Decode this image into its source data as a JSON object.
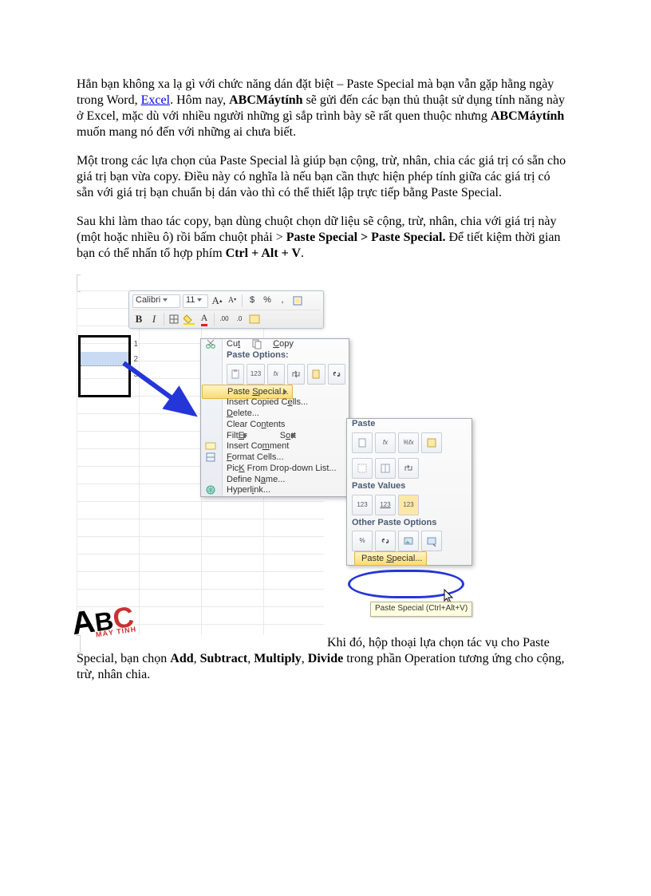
{
  "para1": {
    "t1": "Hẳn bạn không xa lạ gì với chức năng dán đặt biệt – Paste Special mà bạn vẫn gặp hằng ngày trong Word, ",
    "link": "Excel",
    "t2": ". Hôm nay, ",
    "b1": "ABCMáytính",
    "t3": " sẽ gửi đến các bạn thủ thuật sử dụng tính năng này ở Excel, mặc dù với nhiều người những gì sắp trình bày sẽ rất quen thuộc nhưng ",
    "b2": "ABCMáytính",
    "t4": " muốn mang nó đến với những ai chưa biết."
  },
  "para2": "Một trong các lựa chọn của Paste Special là giúp bạn cộng, trừ, nhân, chia các giá trị có sẵn cho giá trị bạn vừa copy. Điều này có nghĩa là nếu bạn cần thực hiện phép tính giữa các giá trị có sẵn với giá trị bạn chuẩn bị dán vào thì có thể thiết lập trực tiếp bằng Paste Special.",
  "para3": {
    "t1": "Sau khi làm thao tác copy, bạn dùng chuột chọn dữ liệu sẽ cộng, trừ, nhân, chia với giá trị này (một hoặc nhiều ô) rồi bấm chuột phải > ",
    "b1": "Paste Special > Paste Special.",
    "t2": " Để tiết kiệm thời gian bạn có thể nhấn tổ hợp phím ",
    "b2": "Ctrl + Alt + V",
    "t3": "."
  },
  "toolbar": {
    "font": "Calibri",
    "size": "11",
    "grow": "A",
    "shrink": "A",
    "cur": "$",
    "pct": "%",
    "comma": ",",
    "bold": "B",
    "ital": "I"
  },
  "ctx": {
    "cut": "t",
    "cut_pre": "Cu",
    "copy": "C",
    "copy_post": "opy",
    "popt": "Paste Options:",
    "p123": "123",
    "pfx": "fx",
    "pfx2": "%fx",
    "ps": "S",
    "ps_pre": "Paste ",
    "ps_post": "pecial...",
    "ic": "e",
    "ic_pre": "Insert Copied C",
    "ic_post": "lls...",
    "del": "D",
    "del_post": "elete...",
    "cc": "n",
    "cc_pre": "Clear Co",
    "cc_post": "tents",
    "fil": "E",
    "fil_pre": "Filt",
    "fil_post": "r",
    "sor": "o",
    "sor_pre": "S",
    "sor_post": "rt",
    "icm": "m",
    "icm_pre": "Insert Co",
    "icm_post": "ment",
    "fc": "F",
    "fc_post": "ormat Cells...",
    "pk": "K",
    "pk_pre": "Pic",
    "pk_post": " From Drop-down List...",
    "dn": "a",
    "dn_pre": "Define N",
    "dn_post": "me...",
    "hl": "i",
    "hl_pre": "Hyperl",
    "hl_post": "nk..."
  },
  "fly": {
    "paste": "Paste",
    "pv": "Paste Values",
    "opo": "Other Paste Options",
    "fx": "fx",
    "pfx": "%fx",
    "v123": "123",
    "pct": "%",
    "ps": "S",
    "ps_pre": "Paste ",
    "ps_post": "pecial..."
  },
  "tooltip": "Paste Special (Ctrl+Alt+V)",
  "logo": {
    "a": "A",
    "b": "B",
    "c": "C",
    "sub": "MÁY TÍNH"
  },
  "para4": {
    "t1": " Khi đó, hộp thoại lựa chọn tác vụ cho Paste Special, bạn chọn ",
    "b1": "Add",
    "c1": ", ",
    "b2": "Subtract",
    "c2": ", ",
    "b3": "Multiply",
    "c3": ", ",
    "b4": "Divide",
    "t2": " trong phần Operation tương ứng cho cộng, trừ, nhân chia."
  }
}
